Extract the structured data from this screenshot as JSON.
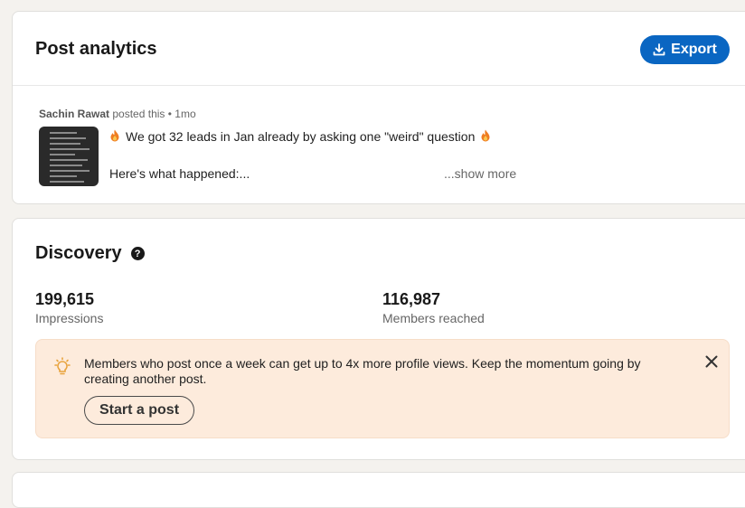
{
  "analytics": {
    "title": "Post analytics",
    "export_label": "Export",
    "post": {
      "author": "Sachin Rawat",
      "meta_suffix": " posted this • 1mo",
      "line1": "We got 32 leads in Jan already by asking one \"weird\" question",
      "line2": "Here's what happened:...",
      "show_more": "...show more",
      "emoji_icon": "flame-emoji",
      "thumbnail": "post-thumbnail-image"
    }
  },
  "discovery": {
    "title": "Discovery",
    "help_glyph": "?",
    "impressions": {
      "value": "199,615",
      "label": "Impressions"
    },
    "members_reached": {
      "value": "116,987",
      "label": "Members reached"
    },
    "tip": {
      "text": "Members who post once a week can get up to 4x more profile views. Keep the momentum going by creating another post.",
      "button_label": "Start a post"
    }
  },
  "colors": {
    "primary": "#0a66c2",
    "tip_background": "#fdebdc",
    "page_background": "#f4f2ee",
    "bulb": "#e8a33d"
  }
}
